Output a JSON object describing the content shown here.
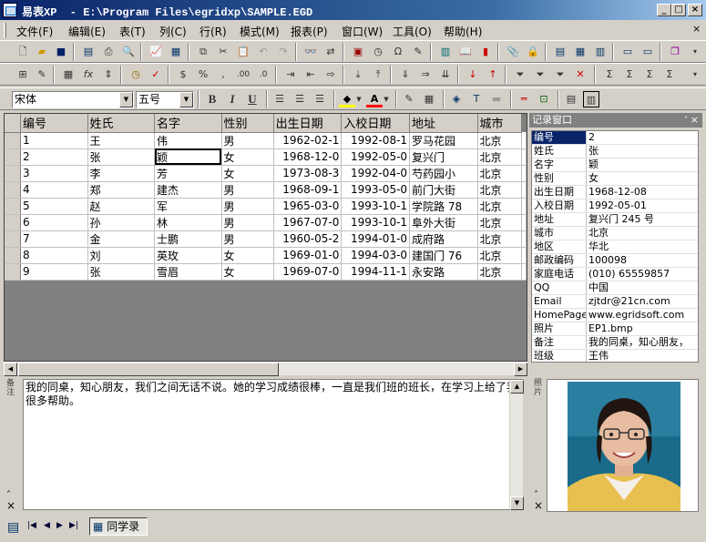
{
  "title": "易表XP  - E:\\Program Files\\egridxp\\SAMPLE.EGD",
  "window_controls": {
    "minimize": "_",
    "maximize": "□",
    "close": "×"
  },
  "menu": [
    "文件(F)",
    "编辑(E)",
    "表(T)",
    "列(C)",
    "行(R)",
    "模式(M)",
    "报表(P)",
    "窗口(W)",
    "工具(O)",
    "帮助(H)"
  ],
  "font_combo": {
    "font": "宋体",
    "size": "五号"
  },
  "format": {
    "bold": "B",
    "italic": "I",
    "underline": "U",
    "font_color_glyph": "A"
  },
  "table": {
    "columns": [
      "编号",
      "姓氏",
      "名字",
      "性别",
      "出生日期",
      "入校日期",
      "地址",
      "城市"
    ],
    "rows": [
      [
        "1",
        "王",
        "伟",
        "男",
        "1962-02-1",
        "1992-08-1",
        "罗马花园",
        "北京"
      ],
      [
        "2",
        "张",
        "颖",
        "女",
        "1968-12-0",
        "1992-05-0",
        "复兴门",
        "北京"
      ],
      [
        "3",
        "李",
        "芳",
        "女",
        "1973-08-3",
        "1992-04-0",
        "芍药园小",
        "北京"
      ],
      [
        "4",
        "郑",
        "建杰",
        "男",
        "1968-09-1",
        "1993-05-0",
        "前门大街",
        "北京"
      ],
      [
        "5",
        "赵",
        "军",
        "男",
        "1965-03-0",
        "1993-10-1",
        "学院路 78",
        "北京"
      ],
      [
        "6",
        "孙",
        "林",
        "男",
        "1967-07-0",
        "1993-10-1",
        "阜外大街",
        "北京"
      ],
      [
        "7",
        "金",
        "士鹏",
        "男",
        "1960-05-2",
        "1994-01-0",
        "成府路",
        "北京"
      ],
      [
        "8",
        "刘",
        "英玫",
        "女",
        "1969-01-0",
        "1994-03-0",
        "建国门 76",
        "北京"
      ],
      [
        "9",
        "张",
        "雪眉",
        "女",
        "1969-07-0",
        "1994-11-1",
        "永安路",
        "北京"
      ]
    ]
  },
  "record_panel": {
    "title": "记录窗口",
    "fields": [
      {
        "k": "编号",
        "v": "2"
      },
      {
        "k": "姓氏",
        "v": "张"
      },
      {
        "k": "名字",
        "v": "颖"
      },
      {
        "k": "性别",
        "v": "女"
      },
      {
        "k": "出生日期",
        "v": "1968-12-08"
      },
      {
        "k": "入校日期",
        "v": "1992-05-01"
      },
      {
        "k": "地址",
        "v": "复兴门 245 号"
      },
      {
        "k": "城市",
        "v": "北京"
      },
      {
        "k": "地区",
        "v": "华北"
      },
      {
        "k": "邮政编码",
        "v": "100098"
      },
      {
        "k": "家庭电话",
        "v": "(010) 65559857"
      },
      {
        "k": "QQ",
        "v": "中国"
      },
      {
        "k": "Email",
        "v": "zjtdr@21cn.com"
      },
      {
        "k": "HomePage",
        "v": "www.egridsoft.com"
      },
      {
        "k": "照片",
        "v": "EP1.bmp"
      },
      {
        "k": "备注",
        "v": "我的同桌，知心朋友，"
      },
      {
        "k": "班级",
        "v": "王伟"
      }
    ]
  },
  "memo": {
    "label": "备注",
    "text": "我的同桌，知心朋友，我们之间无话不说。她的学习成绩很棒，一直是我们班的班长，在学习上给了我很多帮助。"
  },
  "photo": {
    "label": "照片"
  },
  "statusbar": {
    "sheet_tab": "同学录"
  }
}
